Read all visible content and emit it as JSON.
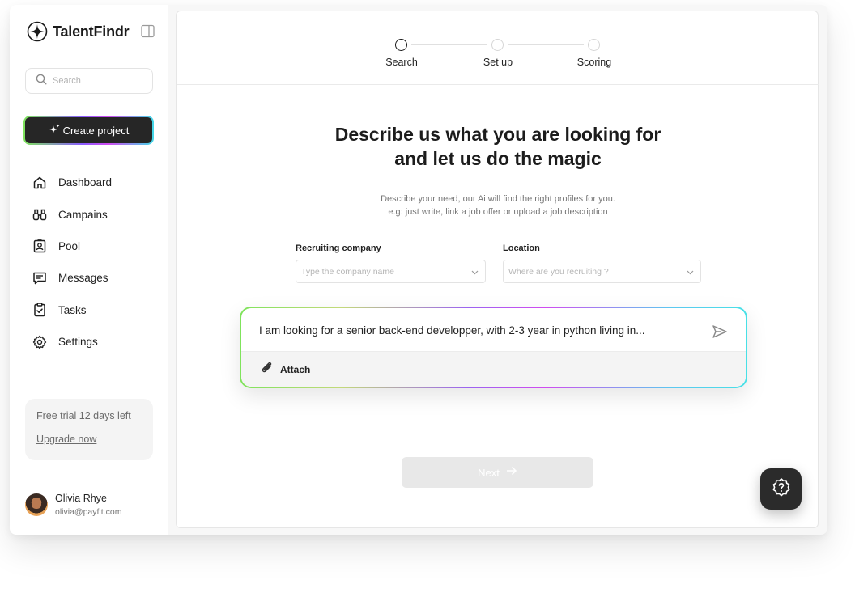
{
  "app": {
    "name": "TalentFindr"
  },
  "sidebar": {
    "search_placeholder": "Search",
    "create_label": "Create project",
    "items": [
      {
        "label": "Dashboard",
        "icon": "home-icon"
      },
      {
        "label": "Campains",
        "icon": "binoculars-icon"
      },
      {
        "label": "Pool",
        "icon": "contact-badge-icon"
      },
      {
        "label": "Messages",
        "icon": "message-icon"
      },
      {
        "label": "Tasks",
        "icon": "clipboard-check-icon"
      },
      {
        "label": "Settings",
        "icon": "gear-icon"
      }
    ],
    "trial": {
      "text": "Free trial 12 days left",
      "link": "Upgrade now"
    },
    "user": {
      "name": "Olivia Rhye",
      "email": "olivia@payfit.com"
    }
  },
  "stepper": {
    "steps": [
      {
        "label": "Search",
        "active": true
      },
      {
        "label": "Set up",
        "active": false
      },
      {
        "label": "Scoring",
        "active": false
      }
    ]
  },
  "main": {
    "headline_line1": "Describe us what you are looking for",
    "headline_line2": "and let us do the magic",
    "sub_line1": "Describe your need, our Ai will find the right profiles for you.",
    "sub_line2": "e.g: just write, link a job offer or upload a job description",
    "company": {
      "label": "Recruiting company",
      "placeholder": "Type the company name"
    },
    "location": {
      "label": "Location",
      "placeholder": "Where are you recruiting ?"
    },
    "prompt": {
      "text": "I am looking for a senior back-end developper, with 2-3 year in python living in...",
      "attach_label": "Attach"
    },
    "next_label": "Next"
  },
  "colors": {
    "accent_dark": "#262626",
    "gradient": [
      "#7ee35b",
      "#8a5cff",
      "#d04bf0",
      "#43d9e8"
    ],
    "disabled_button": "#e8e8e8"
  }
}
